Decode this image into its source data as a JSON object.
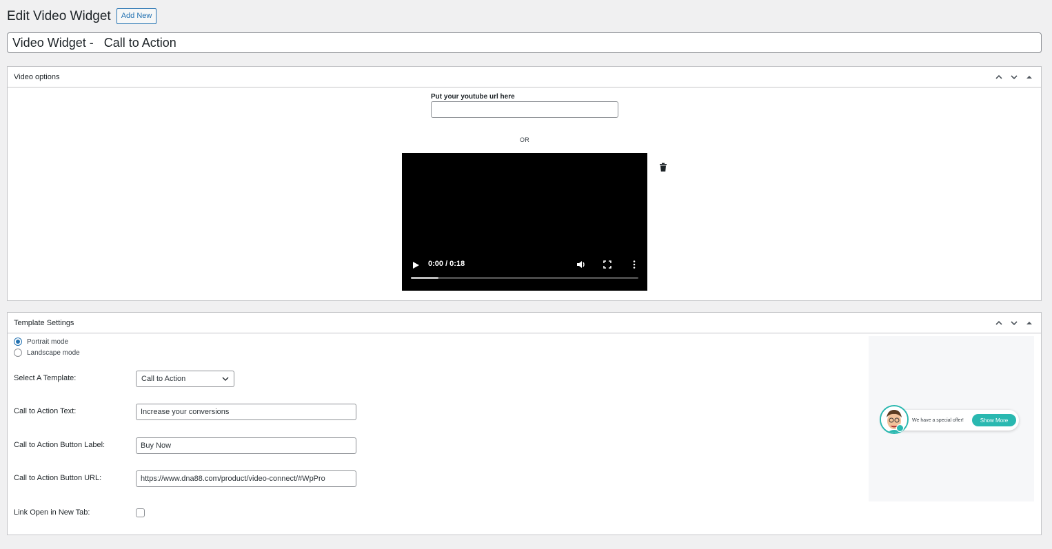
{
  "page": {
    "title": "Edit Video Widget",
    "add_new_label": "Add New",
    "post_title": "Video Widget -   Call to Action"
  },
  "video_options": {
    "title": "Video options",
    "youtube_label": "Put your youtube url here",
    "youtube_value": "",
    "or_text": "OR",
    "player": {
      "time": "0:00 / 0:18",
      "progress_percent": 12
    }
  },
  "template_settings": {
    "title": "Template Settings",
    "modes": [
      {
        "label": "Portrait mode",
        "checked": true
      },
      {
        "label": "Landscape mode",
        "checked": false
      }
    ],
    "select_template_label": "Select A Template:",
    "selected_template": "Call to Action",
    "cta_text_label": "Call to Action Text:",
    "cta_text_value": "Increase your conversions",
    "cta_button_label_label": "Call to Action Button Label:",
    "cta_button_label_value": "Buy Now",
    "cta_button_url_label": "Call to Action Button URL:",
    "cta_button_url_value": "https://www.dna88.com/product/video-connect/#WpPro",
    "new_tab_label": "Link Open in New Tab:",
    "new_tab_checked": false,
    "preview": {
      "message": "We have a special offer!",
      "button": "Show More"
    }
  },
  "colors": {
    "accent": "#2271b1",
    "teal": "#2ab8b0",
    "background": "#f0f0f1"
  },
  "icons": [
    "chevron-up-icon",
    "chevron-down-icon",
    "toggle-arrow-icon",
    "trash-icon",
    "play-icon",
    "volume-icon",
    "fullscreen-icon",
    "more-icon"
  ]
}
